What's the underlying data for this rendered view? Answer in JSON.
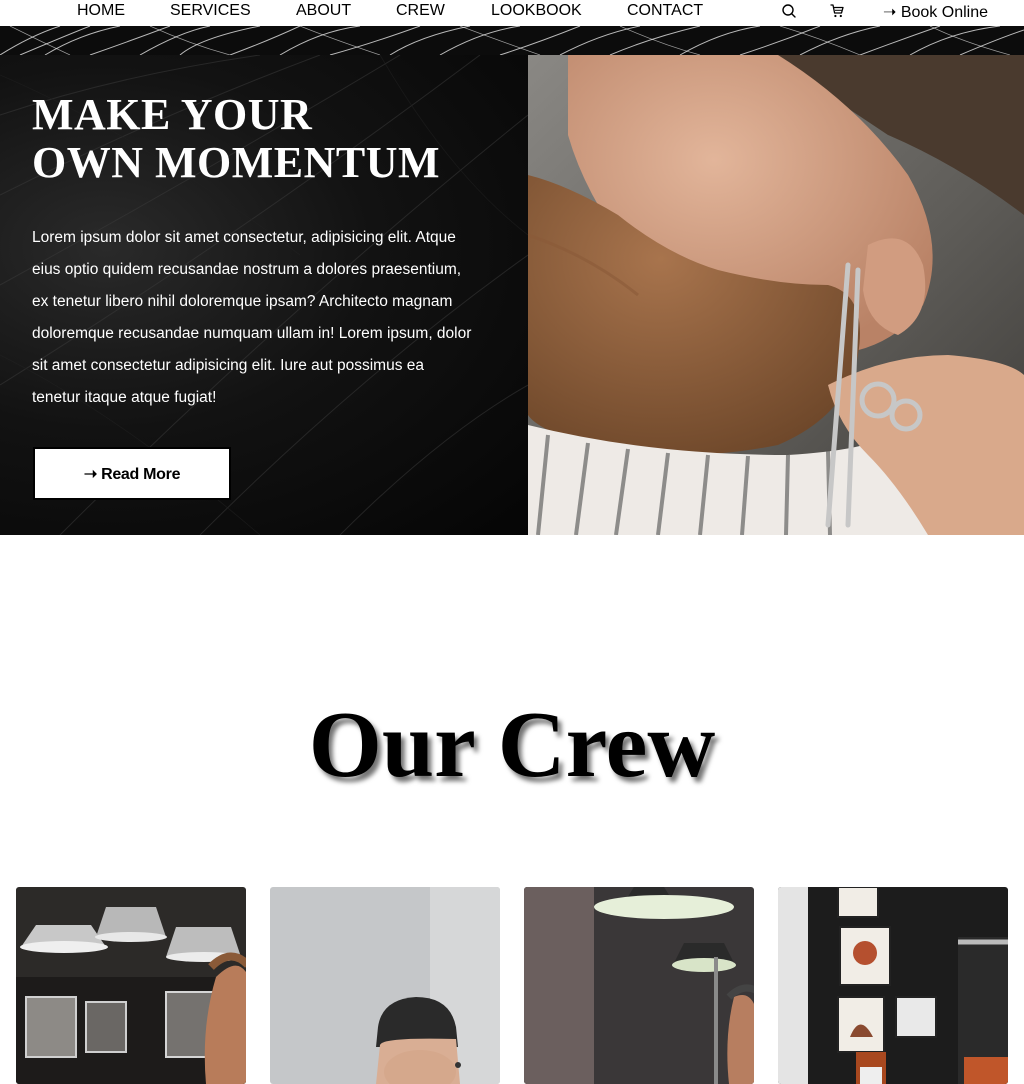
{
  "nav": {
    "items": [
      {
        "label": "HOME"
      },
      {
        "label": "SERVICES"
      },
      {
        "label": "ABOUT"
      },
      {
        "label": "CREW"
      },
      {
        "label": "LOOKBOOK"
      },
      {
        "label": "CONTACT"
      }
    ],
    "icons": [
      "search-icon",
      "cart-icon"
    ],
    "book_label": "➝ Book Online"
  },
  "hero": {
    "title_line1": "MAKE YOUR",
    "title_line2": "OWN MOMENTUM",
    "body": "Lorem ipsum dolor sit amet consectetur, adipisicing elit. Atque eius optio quidem recusandae nostrum a dolores praesentium, ex tenetur libero nihil doloremque ipsam? Architecto magnam doloremque recusandae numquam ullam in! Lorem ipsum, dolor sit amet consectetur adipisicing elit. Iure aut possimus ea tenetur itaque atque fugiat!",
    "button_label": "➝ Read More"
  },
  "crew": {
    "title": "Our Crew",
    "cards": [
      {
        "name": "crew-photo-1"
      },
      {
        "name": "crew-photo-2"
      },
      {
        "name": "crew-photo-3"
      },
      {
        "name": "crew-photo-4"
      }
    ]
  },
  "colors": {
    "hero_bg": "#0d0d0d",
    "text_light": "#ffffff",
    "text_dark": "#000000"
  }
}
